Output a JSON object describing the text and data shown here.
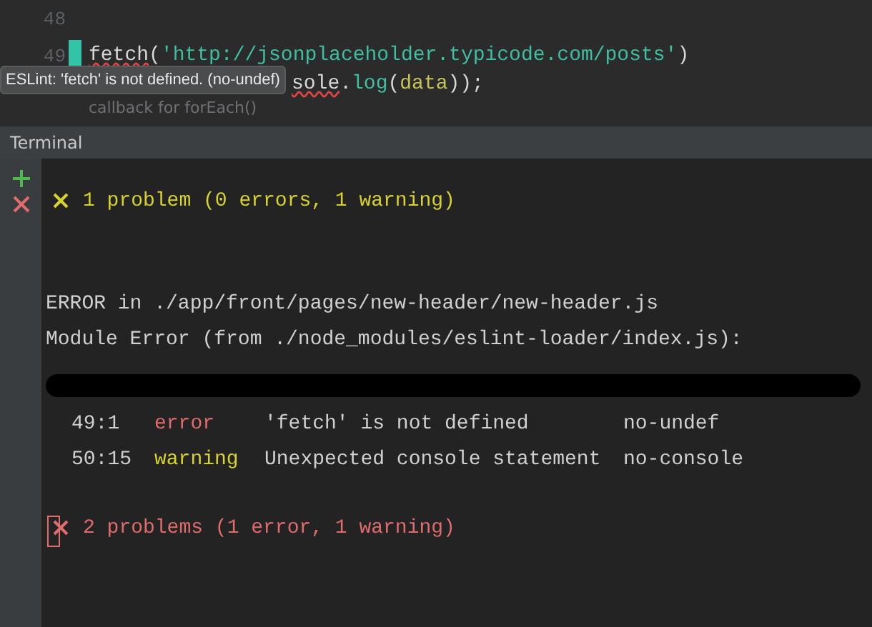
{
  "editor": {
    "lines": [
      {
        "number": "48",
        "changed": false
      },
      {
        "number": "49",
        "changed": true,
        "tokens": [
          {
            "kind": "fn",
            "text": "fetch",
            "squiggle": true
          },
          {
            "kind": "plain",
            "text": "("
          },
          {
            "kind": "string",
            "text": "'http://jsonplaceholder.typicode.com/posts'"
          },
          {
            "kind": "plain",
            "text": ")"
          }
        ]
      },
      {
        "changed": false,
        "tokens": [
          {
            "kind": "plain",
            "text": "sole",
            "squiggle": true
          },
          {
            "kind": "plain",
            "text": "."
          },
          {
            "kind": "method",
            "text": "log"
          },
          {
            "kind": "plain",
            "text": "("
          },
          {
            "kind": "param",
            "text": "data"
          },
          {
            "kind": "plain",
            "text": "));"
          }
        ]
      }
    ],
    "tooltip": "ESLint: 'fetch' is not defined. (no-undef)",
    "hint": "callback for forEach()"
  },
  "terminal": {
    "title": "Terminal",
    "toolbar": [
      {
        "kind": "add"
      },
      {
        "kind": "close"
      }
    ],
    "output": [
      {
        "kind": "summary",
        "color": "#d8d32c",
        "text": "1 problem (0 errors, 1 warning)"
      },
      {
        "kind": "blank"
      },
      {
        "kind": "text",
        "text": "ERROR in ./app/front/pages/new-header/new-header.js"
      },
      {
        "kind": "text",
        "text": "Module Error (from ./node_modules/eslint-loader/index.js):"
      },
      {
        "kind": "redacted"
      },
      {
        "kind": "problem",
        "location": "49:1",
        "severity": "error",
        "message": "'fetch' is not defined",
        "rule": "no-undef"
      },
      {
        "kind": "problem",
        "location": "50:15",
        "severity": "warning",
        "message": "Unexpected console statement",
        "rule": "no-console"
      },
      {
        "kind": "summary",
        "color": "#e06c6c",
        "text": "2 problems (1 error, 1 warning)",
        "cursor": true
      }
    ]
  }
}
